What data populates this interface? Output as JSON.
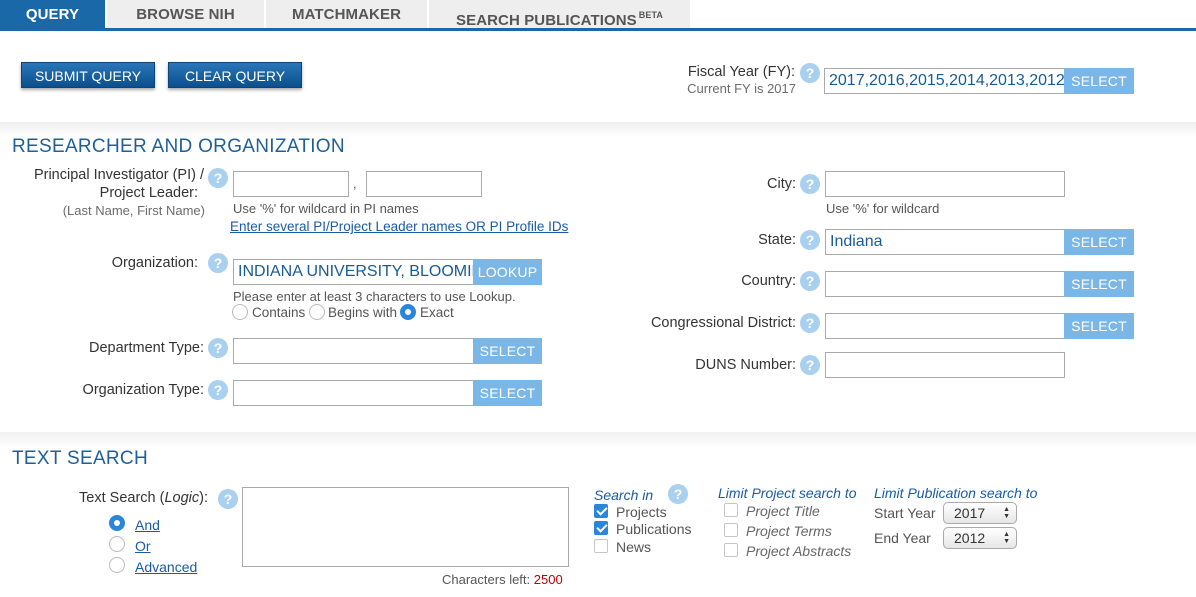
{
  "tabs": [
    {
      "label": "QUERY",
      "sup": ""
    },
    {
      "label": "BROWSE NIH",
      "sup": ""
    },
    {
      "label": "MATCHMAKER",
      "sup": ""
    },
    {
      "label": "SEARCH PUBLICATIONS",
      "sup": "BETA"
    }
  ],
  "toolbar": {
    "submit": "SUBMIT QUERY",
    "clear": "CLEAR QUERY"
  },
  "fiscal_year": {
    "label": "Fiscal Year (FY):",
    "current": "Current FY is 2017",
    "value": "2017,2016,2015,2014,2013,2012",
    "select": "SELECT"
  },
  "help_glyph": "?",
  "researcher": {
    "title": "RESEARCHER AND ORGANIZATION",
    "pi_label_1": "Principal Investigator (PI) /",
    "pi_label_2": "Project Leader:",
    "pi_sub": "(Last Name, First Name)",
    "pi_comma": ",",
    "pi_last": "",
    "pi_first": "",
    "pi_hint": "Use '%' for wildcard in PI names",
    "pi_link": "Enter several PI/Project Leader names OR PI Profile IDs",
    "org_label": "Organization:",
    "org_value": "INDIANA UNIVERSITY, BLOOMINGTON",
    "org_lookup": "LOOKUP",
    "org_hint": "Please enter at least 3 characters to use Lookup.",
    "org_modes": [
      {
        "label": "Contains",
        "selected": false
      },
      {
        "label": "Begins with",
        "selected": false
      },
      {
        "label": "Exact",
        "selected": true
      }
    ],
    "dept_label": "Department Type:",
    "dept_value": "",
    "orgtype_label": "Organization Type:",
    "orgtype_value": "",
    "select": "SELECT",
    "city_label": "City:",
    "city_value": "",
    "city_hint": "Use '%' for wildcard",
    "state_label": "State:",
    "state_value": "Indiana",
    "country_label": "Country:",
    "country_value": "",
    "district_label": "Congressional District:",
    "district_value": "",
    "duns_label": "DUNS Number:",
    "duns_value": ""
  },
  "text_search": {
    "title": "TEXT SEARCH",
    "label_prefix": "Text Search (",
    "label_logic": "Logic",
    "label_suffix": "):",
    "logic_options": [
      {
        "label": "And",
        "selected": true
      },
      {
        "label": "Or",
        "selected": false
      },
      {
        "label": "Advanced",
        "selected": false
      }
    ],
    "value": "",
    "chars_left_label": "Characters left:",
    "chars_left": "2500",
    "search_in_label": "Search in",
    "search_in": [
      {
        "label": "Projects",
        "checked": true
      },
      {
        "label": "Publications",
        "checked": true
      },
      {
        "label": "News",
        "checked": false
      }
    ],
    "limit_project_label": "Limit Project search to",
    "limit_project": [
      {
        "label": "Project Title",
        "checked": false
      },
      {
        "label": "Project Terms",
        "checked": false
      },
      {
        "label": "Project Abstracts",
        "checked": false
      }
    ],
    "limit_pub_label": "Limit Publication search to",
    "start_year_label": "Start Year",
    "start_year": "2017",
    "end_year_label": "End Year",
    "end_year": "2012"
  },
  "colors": {
    "accent": "#1a68a8",
    "button_dark": "#0e5594",
    "button_light": "#7ab6e6",
    "chars_left": "#c00000"
  }
}
